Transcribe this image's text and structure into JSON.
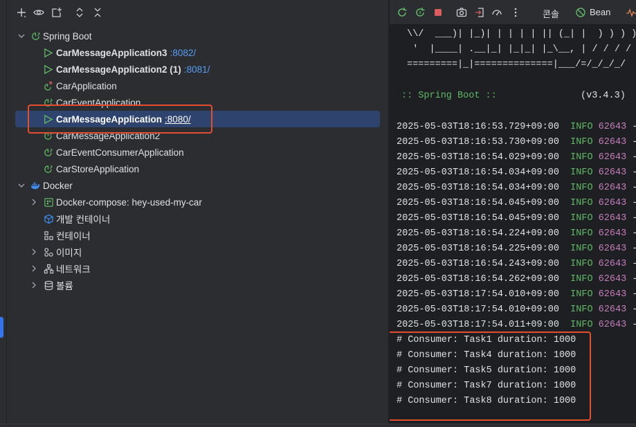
{
  "colors": {
    "accent": "#3574f0",
    "highlight": "#e34e2e",
    "run_green": "#5fb865",
    "port_blue": "#589df6",
    "selection": "#2e436e",
    "pid_purple": "#c77dbb",
    "stop_red": "#db5c5c"
  },
  "services_toolbar": {
    "icons": [
      "add-icon",
      "eye-icon",
      "new-group-icon",
      "expand-all-icon",
      "collapse-all-icon"
    ]
  },
  "tree": {
    "spring_boot": {
      "label": "Spring Boot",
      "apps": [
        {
          "name": "CarMessageApplication3",
          "port": ":8082/",
          "running": true
        },
        {
          "name": "CarMessageApplication2 (1)",
          "port": ":8081/",
          "running": true
        },
        {
          "name": "CarApplication",
          "port": "",
          "running": false,
          "error": true
        },
        {
          "name": "CarEventApplication",
          "port": "",
          "running": false
        },
        {
          "name": "CarMessageApplication",
          "port": ":8080/",
          "running": true,
          "selected": true
        },
        {
          "name": "CarMessageApplication2",
          "port": "",
          "running": false
        },
        {
          "name": "CarEventConsumerApplication",
          "port": "",
          "running": false
        },
        {
          "name": "CarStoreApplication",
          "port": "",
          "running": false
        }
      ]
    },
    "docker": {
      "label": "Docker",
      "items": [
        {
          "label": "Docker-compose: hey-used-my-car",
          "expandable": true,
          "icon": "docker-compose-icon"
        },
        {
          "label": "개발 컨테이너",
          "expandable": false,
          "icon": "dev-container-icon"
        },
        {
          "label": "컨테이너",
          "expandable": false,
          "icon": "containers-icon"
        },
        {
          "label": "이미지",
          "expandable": true,
          "icon": "images-icon"
        },
        {
          "label": "네트워크",
          "expandable": true,
          "icon": "network-icon"
        },
        {
          "label": "볼륨",
          "expandable": true,
          "icon": "volumes-icon"
        }
      ]
    }
  },
  "console_toolbar": {
    "icons": [
      "rerun-icon",
      "restart-icon",
      "stop-icon",
      "screenshot-icon",
      "exit-icon",
      "profiler-icon",
      "more-icon"
    ],
    "console_tab": "콘솔",
    "bean_tab": "Bean"
  },
  "console": {
    "ascii_lines": [
      " \\\\/  ___)| |_)| | | | | || (_| |  ) ) ) )",
      "  '  |____| .__|_| |_|_| |_\\__, | / / / /",
      " =========|_|==============|___/=/_/_/_/"
    ],
    "banner": ":: Spring Boot ::",
    "version": "(v3.4.3)",
    "logs": [
      {
        "ts": "2025-05-03T18:16:53.729+09:00",
        "level": "INFO",
        "pid": "62643",
        "rest": " ---"
      },
      {
        "ts": "2025-05-03T18:16:53.730+09:00",
        "level": "INFO",
        "pid": "62643",
        "rest": " ---"
      },
      {
        "ts": "2025-05-03T18:16:54.029+09:00",
        "level": "INFO",
        "pid": "62643",
        "rest": " ---"
      },
      {
        "ts": "2025-05-03T18:16:54.034+09:00",
        "level": "INFO",
        "pid": "62643",
        "rest": " ---"
      },
      {
        "ts": "2025-05-03T18:16:54.034+09:00",
        "level": "INFO",
        "pid": "62643",
        "rest": " ---"
      },
      {
        "ts": "2025-05-03T18:16:54.045+09:00",
        "level": "INFO",
        "pid": "62643",
        "rest": " ---"
      },
      {
        "ts": "2025-05-03T18:16:54.045+09:00",
        "level": "INFO",
        "pid": "62643",
        "rest": " ---"
      },
      {
        "ts": "2025-05-03T18:16:54.224+09:00",
        "level": "INFO",
        "pid": "62643",
        "rest": " ---"
      },
      {
        "ts": "2025-05-03T18:16:54.225+09:00",
        "level": "INFO",
        "pid": "62643",
        "rest": " ---"
      },
      {
        "ts": "2025-05-03T18:16:54.243+09:00",
        "level": "INFO",
        "pid": "62643",
        "rest": " ---"
      },
      {
        "ts": "2025-05-03T18:16:54.262+09:00",
        "level": "INFO",
        "pid": "62643",
        "rest": " ---"
      },
      {
        "ts": "2025-05-03T18:17:54.010+09:00",
        "level": "INFO",
        "pid": "62643",
        "rest": " ---"
      },
      {
        "ts": "2025-05-03T18:17:54.010+09:00",
        "level": "INFO",
        "pid": "62643",
        "rest": " ---"
      },
      {
        "ts": "2025-05-03T18:17:54.011+09:00",
        "level": "INFO",
        "pid": "62643",
        "rest": " ---"
      }
    ],
    "output": [
      "# Consumer: Task1 duration: 1000",
      "# Consumer: Task4 duration: 1000",
      "# Consumer: Task5 duration: 1000",
      "# Consumer: Task7 duration: 1000",
      "# Consumer: Task8 duration: 1000"
    ]
  }
}
